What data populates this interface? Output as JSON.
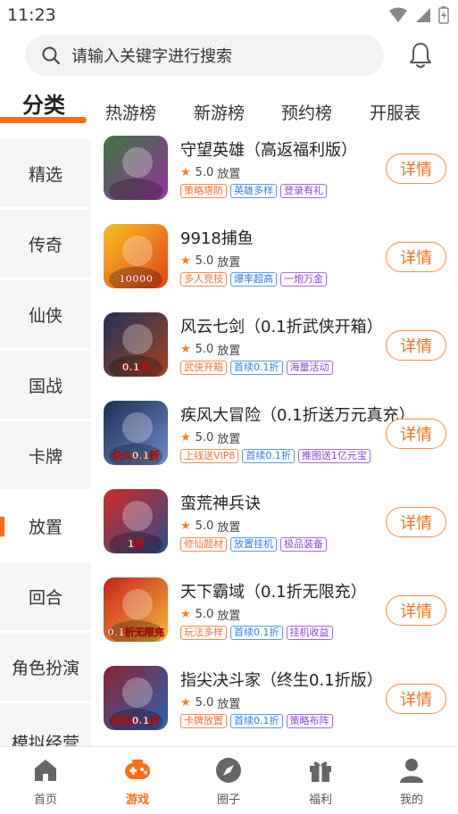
{
  "status_bar": {
    "time": "11:23"
  },
  "search": {
    "placeholder": "请输入关键字进行搜索",
    "icon": "search-icon"
  },
  "header": {
    "bell_icon": "bell-icon"
  },
  "tabs": [
    {
      "label": "分类",
      "active": true
    },
    {
      "label": "热游榜"
    },
    {
      "label": "新游榜"
    },
    {
      "label": "预约榜"
    },
    {
      "label": "开服表"
    }
  ],
  "sidebar": {
    "items": [
      {
        "label": "精选"
      },
      {
        "label": "传奇"
      },
      {
        "label": "仙侠"
      },
      {
        "label": "国战"
      },
      {
        "label": "卡牌"
      },
      {
        "label": "放置",
        "active": true
      },
      {
        "label": "回合"
      },
      {
        "label": "角色扮演"
      },
      {
        "label": "模拟经营"
      }
    ]
  },
  "games": [
    {
      "name": "守望英雄（高返福利版）",
      "rating": "5.0",
      "category": "放置",
      "tags": [
        "策略塔防",
        "英雄多样",
        "登录有礼"
      ],
      "detail_label": "详情",
      "icon_colors": [
        "#3b7a3f",
        "#9b2fa3"
      ],
      "icon_text": ""
    },
    {
      "name": "9918捕鱼",
      "rating": "5.0",
      "category": "放置",
      "tags": [
        "多人竞技",
        "爆率超高",
        "一炮万金"
      ],
      "detail_label": "详情",
      "icon_colors": [
        "#f6c022",
        "#e2421b"
      ],
      "icon_text": "10000"
    },
    {
      "name": "风云七剑（0.1折武侠开箱）",
      "rating": "5.0",
      "category": "放置",
      "tags": [
        "武侠开箱",
        "首续0.1折",
        "海量活动"
      ],
      "detail_label": "详情",
      "icon_colors": [
        "#23305c",
        "#a0451e"
      ],
      "icon_text": "0.1折"
    },
    {
      "name": "疾风大冒险（0.1折送万元真充）",
      "rating": "5.0",
      "category": "放置",
      "tags": [
        "上线送VIP8",
        "首续0.1折",
        "推图送1亿元宝"
      ],
      "detail_label": "详情",
      "icon_colors": [
        "#1c2f55",
        "#6d8bc8"
      ],
      "icon_text": "永久0.1折"
    },
    {
      "name": "蛮荒神兵诀",
      "rating": "5.0",
      "category": "放置",
      "tags": [
        "修仙题材",
        "放置挂机",
        "极品装备"
      ],
      "detail_label": "详情",
      "icon_colors": [
        "#d12d24",
        "#2c4a8f"
      ],
      "icon_text": "1折"
    },
    {
      "name": "天下霸域（0.1折无限充）",
      "rating": "5.0",
      "category": "放置",
      "tags": [
        "玩法多样",
        "首续0.1折",
        "挂机收益"
      ],
      "detail_label": "详情",
      "icon_colors": [
        "#c9221c",
        "#f0b43a"
      ],
      "icon_text": "0.1折无限充"
    },
    {
      "name": "指尖决斗家（终生0.1折版）",
      "rating": "5.0",
      "category": "放置",
      "tags": [
        "卡牌放置",
        "首续0.1折",
        "策略布阵"
      ],
      "detail_label": "详情",
      "icon_colors": [
        "#8a2330",
        "#2c62b8"
      ],
      "icon_text": "终生0.1折"
    }
  ],
  "bottom_nav": [
    {
      "label": "首页",
      "icon": "home-icon"
    },
    {
      "label": "游戏",
      "icon": "gamepad-icon",
      "active": true
    },
    {
      "label": "圈子",
      "icon": "compass-icon"
    },
    {
      "label": "福利",
      "icon": "gift-icon"
    },
    {
      "label": "我的",
      "icon": "user-icon"
    }
  ],
  "colors": {
    "accent": "#ff6d17",
    "tag_orange": "#ff6d2e",
    "tag_blue": "#2f7bf0",
    "tag_purple": "#8d44d8"
  }
}
